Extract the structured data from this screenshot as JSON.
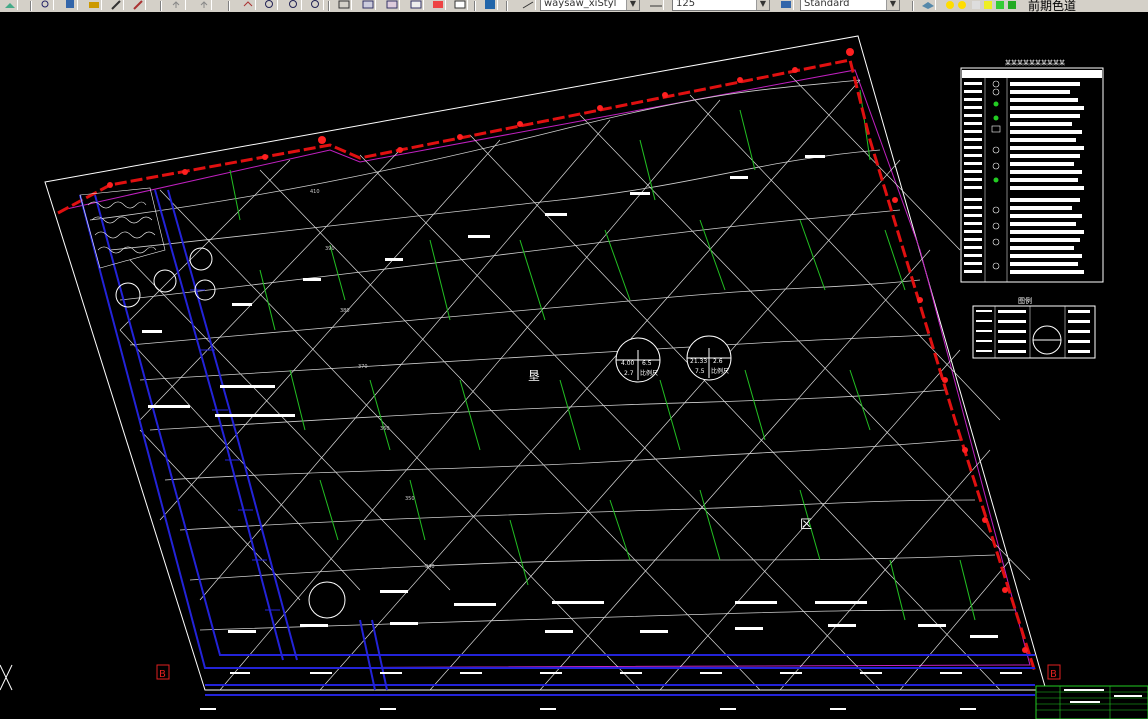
{
  "toolbar": {
    "layer_combo": "waysaw_xiStyl",
    "scale_combo": "125",
    "style_combo": "Standard",
    "layer_name": "前期色道"
  },
  "drawing": {
    "legend_title": "图例",
    "table_title": "某某某某某某某某某某",
    "region_char_1": "垦",
    "region_char_2": "区",
    "marker_left": "B",
    "marker_right": "B",
    "corner_mark": "B",
    "info_circle_1": {
      "tl": "4.00",
      "tr": "6.5",
      "bl": "2.7",
      "br": "比例尺"
    },
    "info_circle_2": {
      "tl": "21.33",
      "tr": "2.6",
      "bl": "7.5",
      "br": "比例尺"
    },
    "contour_labels": [
      "410",
      "390",
      "380",
      "370",
      "360",
      "350",
      "340"
    ]
  },
  "colors": {
    "boundary_red": "#e01010",
    "road_blue": "#2020d0",
    "contour_gray": "#c8c8c8",
    "green_line": "#20c020",
    "magenta": "#c020c0",
    "white": "#ffffff"
  }
}
